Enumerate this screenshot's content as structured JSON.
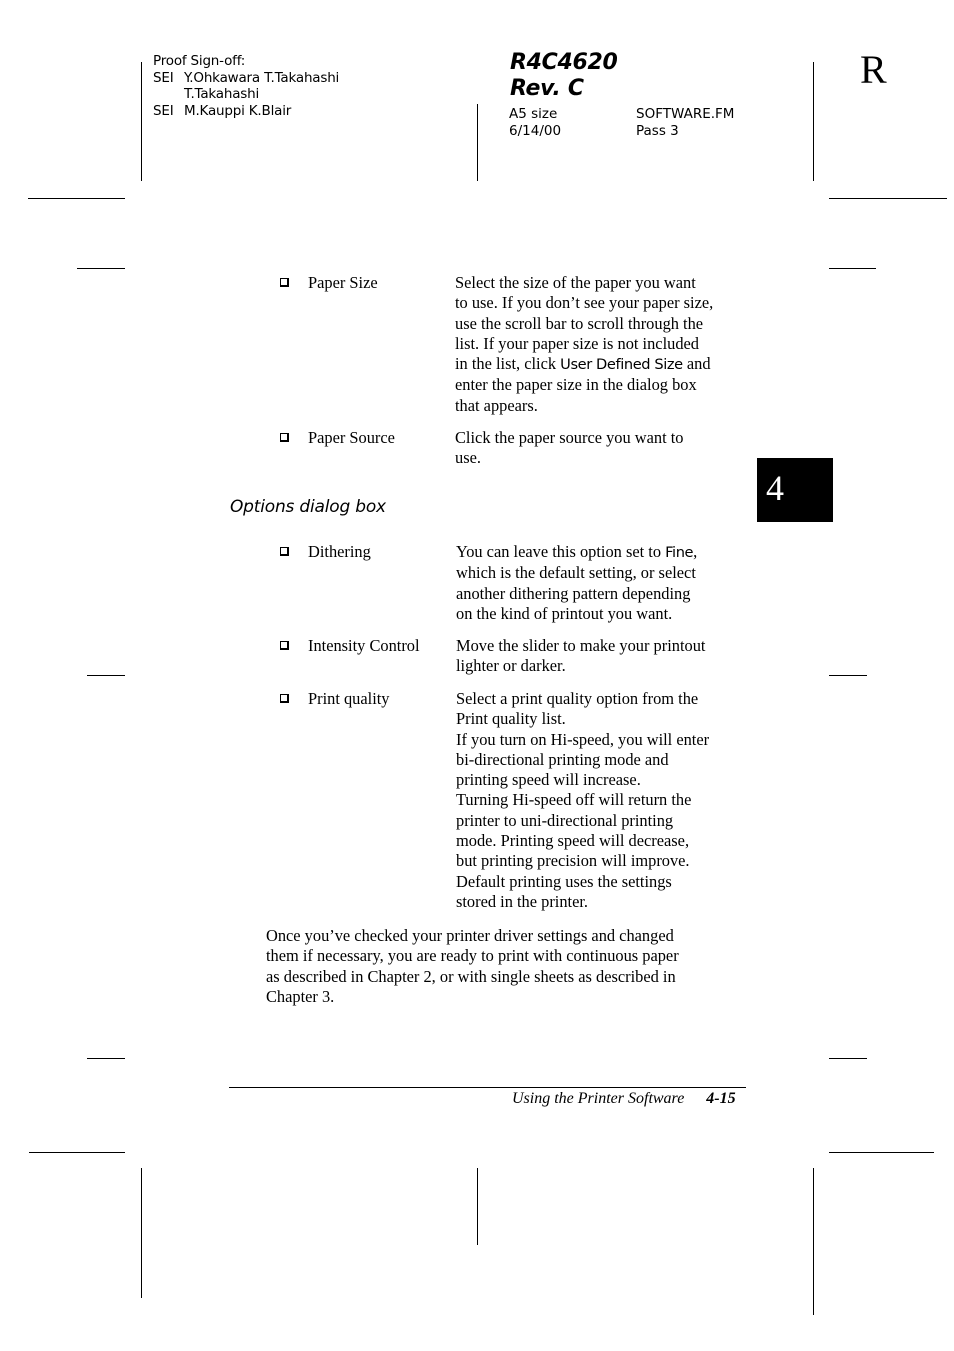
{
  "proof_header": {
    "title": "Proof Sign-off:",
    "rows": [
      {
        "label": "SEI",
        "names": "Y.Ohkawara T.Takahashi"
      },
      {
        "label": "",
        "names": "T.Takahashi"
      },
      {
        "label": "SEI",
        "names": "M.Kauppi K.Blair"
      }
    ]
  },
  "doc_code": {
    "line1": "R4C4620",
    "line2": "Rev. C"
  },
  "doc_meta": {
    "size": "A5 size",
    "file": "SOFTWARE.FM",
    "date": "6/14/00",
    "pass": "Pass 3"
  },
  "corner_mark": "R",
  "chapter_tab": "4",
  "section1": {
    "items": [
      {
        "term": "Paper Size",
        "lines": [
          "Select the size of the paper you want",
          "to use. If you don’t see your paper size,",
          "use the scroll bar to scroll through the",
          "list. If your paper size is not included",
          [
            "in the list, click ",
            "User Defined Size",
            " and"
          ],
          "enter the paper size in the dialog box",
          "that appears."
        ]
      },
      {
        "term": "Paper Source",
        "lines": [
          "Click the paper source you want to",
          "use."
        ]
      }
    ]
  },
  "subheading": "Options dialog box",
  "section2": {
    "items": [
      {
        "term": "Dithering",
        "lines": [
          [
            "You can leave this option set to ",
            "Fine",
            ","
          ],
          "which is the default setting, or select",
          "another dithering pattern depending",
          "on the kind of printout you want."
        ]
      },
      {
        "term": "Intensity Control",
        "lines": [
          "Move the slider to make your printout",
          "lighter or darker."
        ]
      },
      {
        "term": "Print quality",
        "lines": [
          "Select a print quality option from the",
          "Print quality list.",
          "If you turn on Hi-speed, you will enter",
          "bi-directional printing mode and",
          "printing speed will increase.",
          "Turning Hi-speed off will return the",
          "printer to uni-directional printing",
          "mode. Printing speed will decrease,",
          "but printing precision will improve.",
          "Default printing uses the settings",
          "stored in the printer."
        ]
      }
    ]
  },
  "closing_paragraph": [
    "Once you’ve checked your printer driver settings and changed",
    "them if necessary, you are ready to print with continuous paper",
    "as described in Chapter 2, or with single sheets as described in",
    "Chapter 3."
  ],
  "footer": {
    "title": "Using the Printer Software",
    "page": "4-15"
  }
}
